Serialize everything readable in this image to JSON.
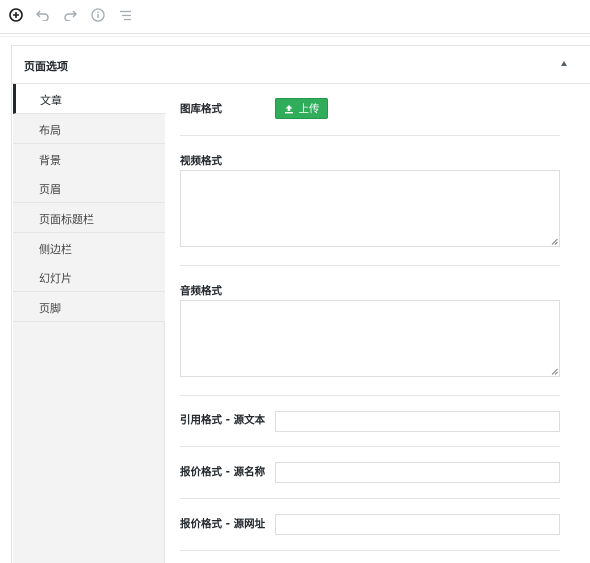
{
  "toolbar": {
    "buttons": [
      {
        "icon": "add-block-icon"
      },
      {
        "icon": "undo-icon"
      },
      {
        "icon": "redo-icon"
      },
      {
        "icon": "info-icon"
      },
      {
        "icon": "list-view-icon"
      }
    ]
  },
  "metabox": {
    "title": "页面选项",
    "tabs": [
      {
        "label": "文章",
        "active": true
      },
      {
        "label": "布局"
      },
      {
        "label": "背景"
      },
      {
        "label": "页眉"
      },
      {
        "label": "页面标题栏"
      },
      {
        "label": "侧边栏"
      },
      {
        "label": "幻灯片"
      },
      {
        "label": "页脚"
      }
    ],
    "fields": {
      "gallery_label": "图库格式",
      "upload_label": "上传",
      "video_label": "视频格式",
      "audio_label": "音频格式",
      "quote_label": "引用格式 - 源文本",
      "link_name_label": "报价格式 - 源名称",
      "link_url_label": "报价格式 - 源网址"
    }
  },
  "colors": {
    "upload_button": "#2fad5a",
    "active_tab_border": "#23282d"
  }
}
